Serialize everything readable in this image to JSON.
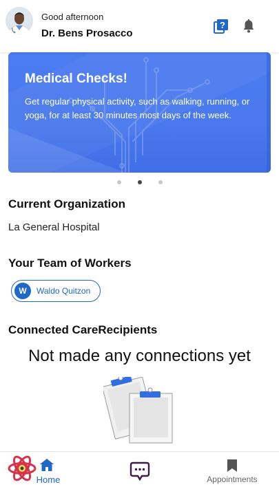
{
  "header": {
    "greeting": "Good afternoon",
    "user_name": "Dr. Bens Prosacco",
    "avatar_icon": "doctor-avatar-icon",
    "help_icon": "help-question-icon",
    "notification_icon": "bell-icon"
  },
  "banner": {
    "title": "Medical Checks!",
    "text": "Get regular physical activity, such as walking, running, or yoga, for at least 30 minutes most days of the week.",
    "accent": "#4b7cf0"
  },
  "carousel": {
    "count": 3,
    "active_index": 1
  },
  "organization": {
    "heading": "Current Organization",
    "name": "La General Hospital"
  },
  "team": {
    "heading": "Your Team of Workers",
    "workers": [
      {
        "initial": "W",
        "name": "Waldo Quitzon"
      }
    ]
  },
  "care_recipients": {
    "heading": "Connected CareRecipients",
    "empty_message": "Not made any connections yet",
    "empty_icon": "clipboard-illustration-icon"
  },
  "bottom_nav": {
    "items": [
      {
        "label": "Home",
        "icon": "home-icon",
        "active": true
      },
      {
        "label": "",
        "icon": "chat-icon",
        "active": false
      },
      {
        "label": "Appointments",
        "icon": "bookmark-icon",
        "active": false
      }
    ],
    "active_color": "#1f67c9",
    "inactive_color": "#666666"
  }
}
